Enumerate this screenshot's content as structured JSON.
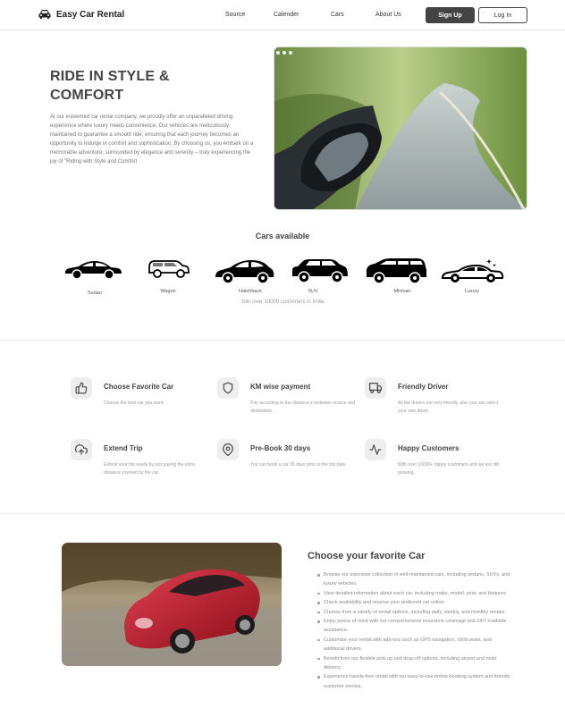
{
  "nav": {
    "brand": "Easy Car Rental",
    "links": [
      "Source",
      "Calender",
      "Cars",
      "About Us"
    ],
    "signup": "Sign Up",
    "login": "Log In"
  },
  "hero": {
    "title": "RIDE IN STYLE & COMFORT",
    "text": "At our esteemed car rental company, we proudly offer an unparalleled driving experience where luxury meets convenience. Our vehicles are meticulously maintained to guarantee a smooth ride, ensuring that each journey becomes an opportunity to indulge in comfort and sophistication. By choosing us, you embark on a memorable adventure, surrounded by elegance and serenity – truly experiencing the joy of \"Riding with Style and Comfort"
  },
  "cars": {
    "title": "Cars available",
    "types": [
      "Sedan",
      "Wagon",
      "Hatchback",
      "SUV",
      "Minivan",
      "Luxury"
    ],
    "customers": "Join over 10000 customers in  India"
  },
  "features": [
    {
      "icon": "thumbs-up-icon",
      "title": "Choose Favorite Car",
      "desc": "Choose the best car you want."
    },
    {
      "icon": "shield-icon",
      "title": "KM wise payment",
      "desc": "Pay according to the distance in between source and destination."
    },
    {
      "icon": "truck-icon",
      "title": "Friendly Driver",
      "desc": "All the drivers are very friendly, also you can select your own driver."
    },
    {
      "icon": "cloud-upload-icon",
      "title": "Extend Trip",
      "desc": "Extend your trip easily by just paying the extra distance covered by the car."
    },
    {
      "icon": "map-pin-icon",
      "title": "Pre-Book 30 days",
      "desc": "You can book a car 30 days prior to  the trip date."
    },
    {
      "icon": "activity-icon",
      "title": "Happy Customers",
      "desc": "With over 10000+ happy customers and we are still growing."
    }
  ],
  "choose": {
    "title": "Choose your favorite Car",
    "items": [
      "Browse our extensive collection of well-maintained cars, including sedans, SUVs, and luxury vehicles.",
      "View detailed information about each car, including make, model, year, and features.",
      "Check availability and reserve your preferred car online.",
      "Choose from a variety of rental options, including daily, weekly, and monthly rentals.",
      "Enjoy peace of mind with our comprehensive insurance coverage and 24/7 roadside assistance.",
      "Customize your rental with add-ons such as GPS navigation, child seats, and additional drivers.",
      "Benefit from our flexible pick-up and drop-off options, including airport and hotel delivery.",
      "Experience hassle-free rental with our easy-to-use online booking system and friendly customer service."
    ]
  }
}
